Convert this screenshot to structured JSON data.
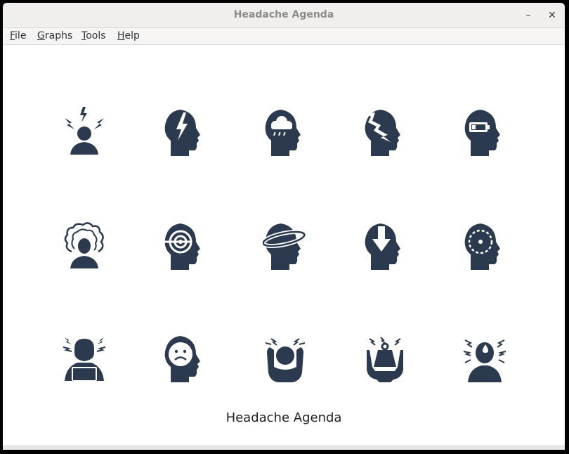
{
  "window": {
    "title": "Headache Agenda",
    "minimize_glyph": "–",
    "close_glyph": "✕"
  },
  "menu": {
    "items": [
      {
        "label": "File",
        "mnemonic": "F",
        "rest": "ile"
      },
      {
        "label": "Graphs",
        "mnemonic": "G",
        "rest": "raphs"
      },
      {
        "label": "Tools",
        "mnemonic": "T",
        "rest": "ools"
      },
      {
        "label": "Help",
        "mnemonic": "H",
        "rest": "elp"
      }
    ]
  },
  "icons": [
    "stress-person-lightning-icon",
    "head-lightning-icon",
    "head-storm-cloud-icon",
    "head-cracked-icon",
    "head-low-battery-icon",
    "person-frazzled-hair-icon",
    "head-target-icon",
    "head-orbit-ring-icon",
    "head-down-arrow-icon",
    "head-dashed-circle-icon",
    "person-laptop-stress-icon",
    "head-sad-face-icon",
    "person-hands-on-head-icon",
    "person-lifting-weight-icon",
    "person-sweating-stress-icon"
  ],
  "colors": {
    "icon": "#2b3a4e",
    "background": "#ffffff",
    "titlebar": "#f0efee"
  },
  "caption": "Headache Agenda"
}
